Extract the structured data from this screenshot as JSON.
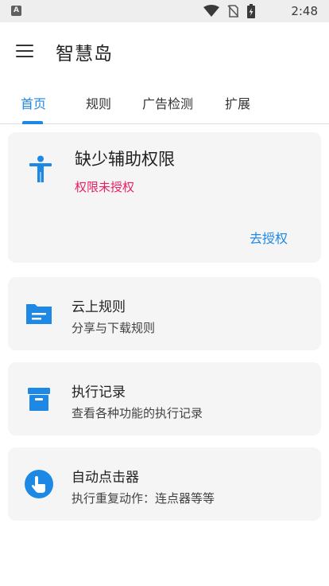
{
  "status_bar": {
    "notification_letter": "A",
    "time": "2:48",
    "icons": [
      "wifi-icon",
      "no-sim-icon",
      "battery-icon"
    ]
  },
  "app_bar": {
    "title": "智慧岛",
    "menu_icon": "hamburger-menu-icon"
  },
  "tabs": [
    {
      "label": "首页",
      "active": true
    },
    {
      "label": "规则",
      "active": false
    },
    {
      "label": "广告检测",
      "active": false
    },
    {
      "label": "扩展",
      "active": false
    }
  ],
  "permission_card": {
    "icon": "accessibility-icon",
    "title": "缺少辅助权限",
    "subtitle": "权限未授权",
    "action": "去授权"
  },
  "feature_cards": [
    {
      "icon": "folder-icon",
      "title": "云上规则",
      "subtitle": "分享与下载规则"
    },
    {
      "icon": "archive-icon",
      "title": "执行记录",
      "subtitle": "查看各种功能的执行记录"
    },
    {
      "icon": "touch-icon",
      "title": "自动点击器",
      "subtitle": "执行重复动作：连点器等等"
    }
  ],
  "colors": {
    "accent": "#1e88e5",
    "warning": "#e91e63",
    "card_background": "#f5f5f5",
    "status_bar": "#eeeeee"
  }
}
